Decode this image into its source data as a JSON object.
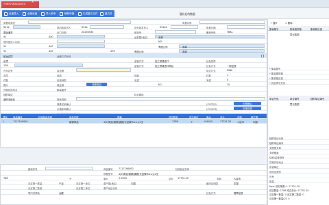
{
  "tab": {
    "label": "THMT7SNSS1SN7S",
    "close": "×"
  },
  "toolbar": {
    "buttons": [
      "页面导入",
      "全部页面",
      "导入单申",
      "随附申报",
      "生成复文文件",
      "复文件"
    ],
    "title": "暂存后的数据"
  },
  "form": {
    "r1": {
      "a": "申报地海关",
      "b": "申报口岸"
    },
    "r2": {
      "a": "5312",
      "b": "境内收发货人",
      "c": "5314",
      "d": "境外收发货人",
      "e": "53142",
      "f": "申报日期"
    },
    "r3": {
      "a": "原始通关",
      "b": "出口日期",
      "c": "20250530",
      "d": "航班号",
      "e": "备案号码",
      "f": "TBAL"
    },
    "r4": {
      "a": "91",
      "b": "440",
      "c": "运抵国(地区)",
      "d": "深圳"
    },
    "r5": {
      "a": "境内发货人代码",
      "b": "NO"
    },
    "r6": {
      "a": "91",
      "b": "440",
      "c": "有限公司",
      "d": "深圳"
    },
    "r7": {
      "a": "91",
      "b": "440",
      "c": "476",
      "d": "有限公司",
      "e": "深圳"
    },
    "r8": {
      "a": "航运边境",
      "b": "运输方式代码"
    },
    "r9": {
      "a": "出境",
      "b": "监管方式",
      "c": "加工贸易进口",
      "d": "征免性质"
    },
    "r10": {
      "a": "12N",
      "b": "监管方式",
      "c": "加工贸易进口项目",
      "d": "征免方式",
      "e": "一般征税"
    },
    "r11": {
      "a": "许可证号",
      "b": "启运港",
      "c": "成交方式",
      "d": "EXW"
    },
    "r12": {
      "a": "合同",
      "b": "运费",
      "c": "保费",
      "d": "件数",
      "e": "1"
    },
    "r13": {
      "a": "件数",
      "b": "包装种类",
      "c": "毛重",
      "d": "净重",
      "e": "0"
    },
    "r14": {
      "a": "照片",
      "b": "装运港",
      "c": "KG",
      "d": "10"
    },
    "r15": {
      "a": "货物存放地点",
      "b": "集装箱号"
    },
    "r16": {
      "a": "随附单证",
      "b": "标记唛码"
    },
    "r17": {
      "a": "通关无纸化",
      "b": "其他说明"
    },
    "r18": {
      "a": "特殊关系确认",
      "b": "(ZIS平均)",
      "c": "价格影响确认"
    },
    "r19": {
      "a": "(ZIVJ平均)",
      "b": "支付特许权使用费确认"
    },
    "special_btn": "特殊附加",
    "r18_btn": "价格确认",
    "r19_btn": "自报自缴"
  },
  "grid": {
    "headers": [
      "项号",
      "商品编号",
      "检验检疫名称",
      "商品名称",
      "规格",
      "成交数量",
      "成交单位",
      "单价",
      "总价",
      "币制",
      "原产国"
    ],
    "rows": [
      [
        "1",
        "7117190000",
        "",
        "镀铜饰品",
        "4|0|饰品|镀铜|镀铜|无品牌|Fancy|2无",
        "1788",
        "个",
        "9.9000",
        "17701.20",
        "人民币",
        "中国"
      ]
    ]
  },
  "detail": {
    "r1": {
      "a": "备案序号",
      "b": "商品编号",
      "c": "7117190000",
      "d": "检验检疫名称"
    },
    "r2": {
      "a": "规格型号",
      "b": "4|0|饰品|镀铜|镀铜|无品牌|Fancy|2无"
    },
    "r3": {
      "a": "788",
      "b": "个",
      "c": "单价",
      "d": "9.9000",
      "e": "总价",
      "f": "17701.20",
      "g": "币制",
      "h": "人民币"
    },
    "r4": {
      "a": "法定第一数量",
      "b": "千克",
      "c": "法定第一单位",
      "d": "原产国(地区)",
      "e": "中国",
      "f": "最终目的国",
      "g": "中国"
    },
    "r5": {
      "a": "法定第二数量",
      "b": "法定第二单位",
      "c": "原产地区代码"
    },
    "r6": {
      "a": "境内货源地",
      "b": "汕尾",
      "c": "征免方式",
      "d": "照章征税"
    }
  },
  "side": {
    "tools": [
      "+ 插字",
      "× 删除"
    ],
    "table1": {
      "headers": [
        "集装箱号",
        "集装箱规格",
        "集装箱自重"
      ],
      "empty": "暂无数据"
    },
    "fields": [
      "* 集装箱号",
      "* 集装箱规格",
      "* 集装箱自重",
      "* 商品项号关系"
    ],
    "table2": {
      "headers": [
        "单证代码",
        "单证编号",
        "随附单证编号"
      ],
      "empty": "暂无数据"
    },
    "fields2": [
      "随附单证代码",
      "随附单证编号",
      "关联报关单",
      "关联备案",
      "保税/监管场所",
      "货物存放地点",
      "申请单位",
      "危险品类别",
      "货号",
      "数量"
    ],
    "summary": {
      "lines": [
        "Npo: 成分条数: 1    17701.20",
        "成交数量: 1788    成交总价: 17701.20",
        "法定第一数量: 0    法定第二数量: 0",
        "法定第一数量(2): 0"
      ]
    }
  }
}
